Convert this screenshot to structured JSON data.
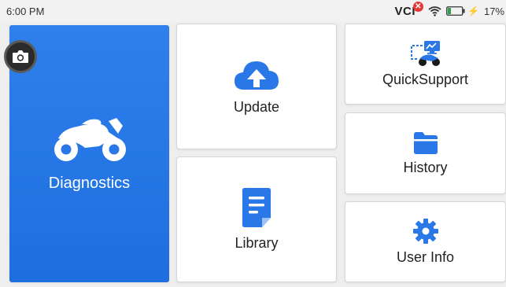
{
  "status_bar": {
    "time": "6:00 PM",
    "vci_label": "VCI",
    "vci_status_mark": "✕",
    "battery_percent": "17%"
  },
  "tiles": {
    "diagnostics": {
      "label": "Diagnostics",
      "icon": "motorcycle-icon"
    },
    "update": {
      "label": "Update",
      "icon": "cloud-upload-icon"
    },
    "library": {
      "label": "Library",
      "icon": "document-icon"
    },
    "quicksupport": {
      "label": "QuickSupport",
      "icon": "remote-support-icon"
    },
    "history": {
      "label": "History",
      "icon": "folder-icon"
    },
    "user_info": {
      "label": "User Info",
      "icon": "gear-icon"
    }
  },
  "overlay": {
    "icon": "camera-icon"
  },
  "colors": {
    "accent": "#1e6ee0",
    "vci_error": "#e53935",
    "battery_fill": "#2e9e4f"
  }
}
